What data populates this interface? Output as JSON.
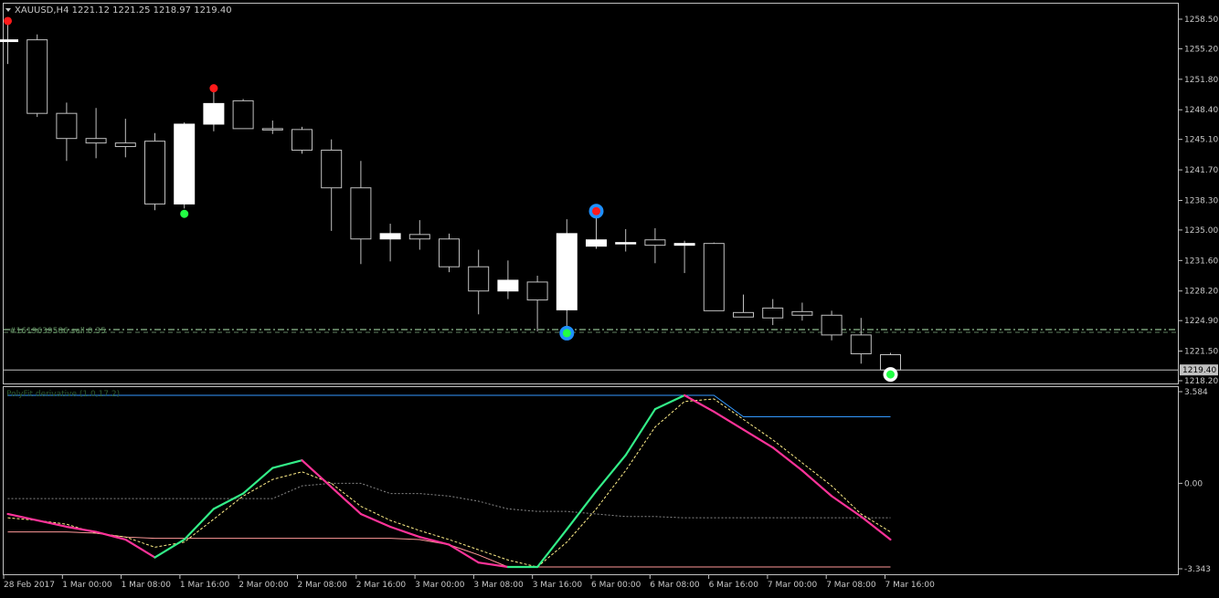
{
  "main_chart": {
    "title": "XAUUSD,H4  1221.12 1221.25 1218.97 1219.40",
    "current_price": "1219.40",
    "price_labels": [
      "1258.50",
      "1255.20",
      "1251.80",
      "1248.40",
      "1245.10",
      "1241.70",
      "1238.30",
      "1235.00",
      "1231.60",
      "1228.20",
      "1224.90",
      "1221.50",
      "1218.20"
    ],
    "order_line_label": "#1619639586 sell 0.35",
    "colors": {
      "background": "#000000",
      "frame": "#c0c0c0",
      "text": "#c8c8c8",
      "candle_bull": "#ffffff",
      "candle_bear": "#000000",
      "order_line": "#8fbc8f",
      "bid_line": "#c0c0c0"
    }
  },
  "subwindow": {
    "title": "PolyFit derivative (1.0,17.2)",
    "scale_labels": [
      "3.584",
      "0.00",
      "-3.343"
    ]
  },
  "time_labels": [
    "28 Feb 2017",
    "1 Mar 00:00",
    "1 Mar 08:00",
    "1 Mar 16:00",
    "2 Mar 00:00",
    "2 Mar 08:00",
    "2 Mar 16:00",
    "3 Mar 00:00",
    "3 Mar 08:00",
    "3 Mar 16:00",
    "6 Mar 00:00",
    "6 Mar 08:00",
    "6 Mar 16:00",
    "7 Mar 00:00",
    "7 Mar 08:00",
    "7 Mar 16:00"
  ],
  "chart_data": {
    "type": "candlestick",
    "symbol": "XAUUSD",
    "timeframe": "H4",
    "ylim": [
      1217.5,
      1260.0
    ],
    "candles": [
      {
        "o": 1256.0,
        "h": 1258.5,
        "l": 1253.5,
        "c": 1256.2
      },
      {
        "o": 1256.2,
        "h": 1256.8,
        "l": 1247.6,
        "c": 1248.0
      },
      {
        "o": 1248.0,
        "h": 1249.2,
        "l": 1242.7,
        "c": 1245.2
      },
      {
        "o": 1245.2,
        "h": 1248.6,
        "l": 1243.0,
        "c": 1244.7
      },
      {
        "o": 1244.7,
        "h": 1247.4,
        "l": 1243.1,
        "c": 1244.3
      },
      {
        "o": 1244.9,
        "h": 1245.8,
        "l": 1237.2,
        "c": 1237.9
      },
      {
        "o": 1237.9,
        "h": 1247.0,
        "l": 1237.4,
        "c": 1246.8
      },
      {
        "o": 1246.8,
        "h": 1250.4,
        "l": 1246.0,
        "c": 1249.1
      },
      {
        "o": 1249.4,
        "h": 1249.6,
        "l": 1246.3,
        "c": 1246.3
      },
      {
        "o": 1246.3,
        "h": 1247.2,
        "l": 1245.7,
        "c": 1246.2
      },
      {
        "o": 1246.2,
        "h": 1246.5,
        "l": 1243.5,
        "c": 1243.9
      },
      {
        "o": 1243.9,
        "h": 1245.1,
        "l": 1234.9,
        "c": 1239.7
      },
      {
        "o": 1239.7,
        "h": 1242.7,
        "l": 1231.2,
        "c": 1234.0
      },
      {
        "o": 1234.0,
        "h": 1235.7,
        "l": 1231.5,
        "c": 1234.6
      },
      {
        "o": 1234.5,
        "h": 1236.1,
        "l": 1232.8,
        "c": 1234.0
      },
      {
        "o": 1234.0,
        "h": 1234.6,
        "l": 1230.3,
        "c": 1230.9
      },
      {
        "o": 1230.9,
        "h": 1232.8,
        "l": 1225.6,
        "c": 1228.2
      },
      {
        "o": 1228.2,
        "h": 1231.6,
        "l": 1227.3,
        "c": 1229.4
      },
      {
        "o": 1229.2,
        "h": 1229.9,
        "l": 1223.7,
        "c": 1227.2
      },
      {
        "o": 1226.1,
        "h": 1236.2,
        "l": 1223.6,
        "c": 1234.6
      },
      {
        "o": 1233.2,
        "h": 1236.8,
        "l": 1232.9,
        "c": 1233.9
      },
      {
        "o": 1233.6,
        "h": 1235.1,
        "l": 1232.6,
        "c": 1233.6
      },
      {
        "o": 1233.9,
        "h": 1235.2,
        "l": 1231.3,
        "c": 1233.3
      },
      {
        "o": 1233.3,
        "h": 1233.8,
        "l": 1230.2,
        "c": 1233.5
      },
      {
        "o": 1233.5,
        "h": 1233.6,
        "l": 1226.0,
        "c": 1226.0
      },
      {
        "o": 1225.8,
        "h": 1227.8,
        "l": 1225.3,
        "c": 1225.3
      },
      {
        "o": 1226.3,
        "h": 1227.3,
        "l": 1224.4,
        "c": 1225.2
      },
      {
        "o": 1225.9,
        "h": 1226.9,
        "l": 1224.9,
        "c": 1225.5
      },
      {
        "o": 1225.5,
        "h": 1226.0,
        "l": 1222.7,
        "c": 1223.3
      },
      {
        "o": 1223.3,
        "h": 1225.2,
        "l": 1220.1,
        "c": 1221.2
      },
      {
        "o": 1221.1,
        "h": 1221.3,
        "l": 1218.9,
        "c": 1219.4
      }
    ],
    "signals": [
      {
        "type": "sell",
        "candle": 0,
        "price": 1258.3
      },
      {
        "type": "buy",
        "candle": 6,
        "price": 1236.8
      },
      {
        "type": "sell",
        "candle": 7,
        "price": 1250.8
      },
      {
        "type": "buy",
        "candle": 19,
        "price": 1223.5,
        "ring": true
      },
      {
        "type": "sell",
        "candle": 20,
        "price": 1237.1,
        "ring": true
      },
      {
        "type": "buy",
        "candle": 30,
        "price": 1218.9,
        "ring": true
      }
    ],
    "order_price": 1223.9,
    "indicator": {
      "name": "PolyFit derivative (1.0,17.2)",
      "ylim": [
        -3.343,
        3.584
      ],
      "x": [
        0,
        1,
        2,
        3,
        4,
        5,
        6,
        7,
        8,
        9,
        10,
        11,
        12,
        13,
        14,
        15,
        16,
        17,
        18,
        19,
        20,
        21,
        22,
        23,
        24,
        25,
        26,
        27,
        28,
        29,
        30
      ],
      "fast": [
        -1.2,
        -1.45,
        -1.7,
        -1.9,
        -2.2,
        -2.9,
        -2.2,
        -1.0,
        -0.4,
        0.6,
        0.9,
        -0.15,
        -1.2,
        -1.7,
        -2.1,
        -2.4,
        -3.1,
        -3.3,
        -3.3,
        -1.8,
        -0.3,
        1.1,
        2.9,
        3.5,
        2.8,
        2.1,
        1.4,
        0.5,
        -0.5,
        -1.3,
        -2.2
      ],
      "signal_dashed": [
        -1.35,
        -1.45,
        -1.6,
        -1.95,
        -2.1,
        -2.5,
        -2.3,
        -1.4,
        -0.5,
        0.15,
        0.45,
        0.0,
        -0.9,
        -1.45,
        -1.85,
        -2.2,
        -2.6,
        -3.0,
        -3.3,
        -2.3,
        -1.0,
        0.5,
        2.2,
        3.2,
        3.3,
        2.5,
        1.7,
        0.8,
        -0.1,
        -1.2,
        -1.9
      ],
      "upper_band": [
        7.0,
        7.0,
        7.0,
        7.0,
        7.0,
        7.0,
        7.0,
        7.0,
        7.0,
        7.0,
        7.0,
        7.0,
        7.0,
        7.0,
        7.0,
        7.0,
        7.0,
        7.0,
        7.0,
        7.0,
        6.9,
        6.3,
        5.2,
        3.9,
        3.8,
        2.6,
        2.6,
        2.6,
        2.6,
        2.6,
        2.6
      ],
      "lower_band": [
        -1.9,
        -1.9,
        -1.9,
        -1.95,
        -2.1,
        -2.15,
        -2.15,
        -2.15,
        -2.15,
        -2.15,
        -2.15,
        -2.15,
        -2.15,
        -2.15,
        -2.2,
        -2.4,
        -2.8,
        -3.3,
        -3.35,
        -3.35,
        -3.35,
        -3.35,
        -3.35,
        -3.35,
        -3.35,
        -3.35,
        -3.35,
        -3.35,
        -3.35,
        -3.35,
        -3.35
      ],
      "mid_dotted": [
        -0.6,
        -0.6,
        -0.6,
        -0.6,
        -0.6,
        -0.6,
        -0.6,
        -0.6,
        -0.6,
        -0.6,
        -0.1,
        0.0,
        0.0,
        -0.4,
        -0.4,
        -0.5,
        -0.7,
        -1.0,
        -1.1,
        -1.1,
        -1.2,
        -1.3,
        -1.3,
        -1.35,
        -1.35,
        -1.35,
        -1.35,
        -1.35,
        -1.35,
        -1.35,
        -1.35
      ],
      "colors": {
        "up": "#33ee88",
        "down": "#ff3399",
        "upper": "#3399ff",
        "lower": "#ff9999",
        "signal": "#ffee88",
        "mid": "#888888"
      }
    }
  }
}
